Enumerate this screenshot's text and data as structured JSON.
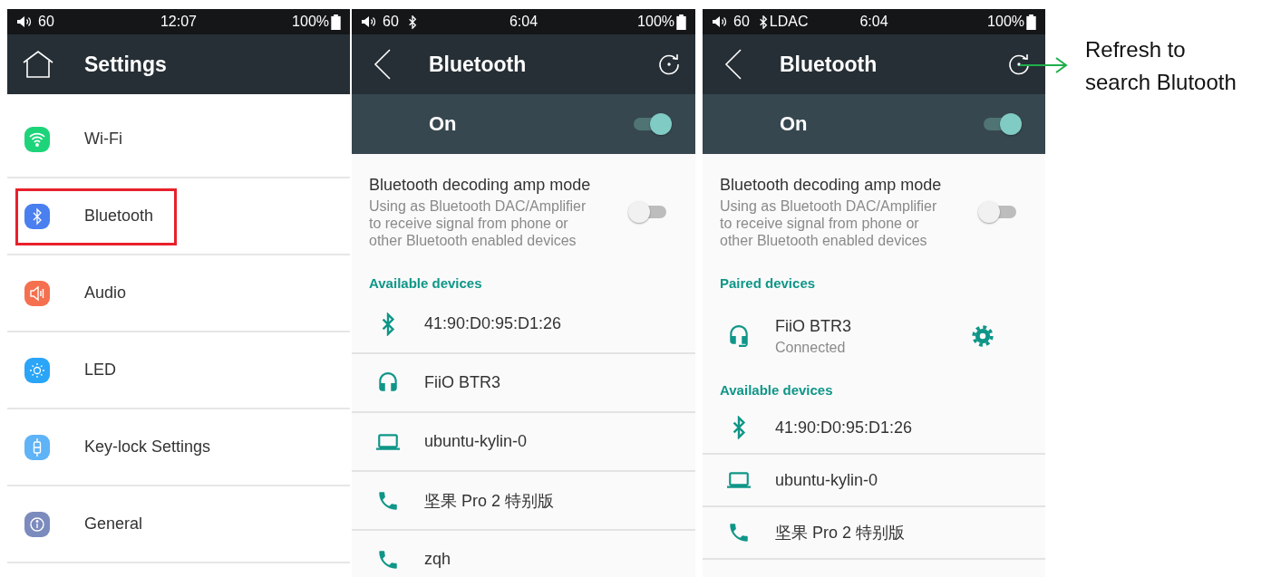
{
  "screens": [
    {
      "kind": "settings",
      "status_bar": {
        "volume": "60",
        "bluetooth": false,
        "time": "12:07",
        "battery": "100%"
      },
      "header": {
        "title": "Settings"
      },
      "items": [
        {
          "label": "Wi-Fi",
          "kind": "wifi",
          "color": "#1ed47a",
          "highlighted": false
        },
        {
          "label": "Bluetooth",
          "kind": "bluetooth",
          "color": "#4a7ff0",
          "highlighted": true
        },
        {
          "label": "Audio",
          "kind": "audio",
          "color": "#f4704f",
          "highlighted": false
        },
        {
          "label": "LED",
          "kind": "led",
          "color": "#2aa5f8",
          "highlighted": false
        },
        {
          "label": "Key-lock Settings",
          "kind": "keylock",
          "color": "#5fb3f7",
          "highlighted": false
        },
        {
          "label": "General",
          "kind": "general",
          "color": "#7c8bbd",
          "highlighted": false
        }
      ]
    },
    {
      "kind": "bluetooth",
      "status_bar": {
        "volume": "60",
        "bluetooth": true,
        "time": "6:04",
        "battery": "100%"
      },
      "header": {
        "title": "Bluetooth"
      },
      "switch": {
        "label": "On",
        "on": true
      },
      "amp_mode": {
        "title": "Bluetooth decoding amp mode",
        "description": "Using as Bluetooth DAC/Amplifier to receive signal from phone or other Bluetooth enabled devices",
        "on": false
      },
      "sections": [
        {
          "heading": "Available devices",
          "devices": [
            {
              "name": "41:90:D0:95:D1:26",
              "kind": "bluetooth",
              "has_settings": false
            },
            {
              "name": "FiiO BTR3",
              "kind": "headphones",
              "has_settings": false
            },
            {
              "name": "ubuntu-kylin-0",
              "kind": "laptop",
              "has_settings": false
            },
            {
              "name": "坚果 Pro 2 特别版",
              "kind": "phone",
              "has_settings": false
            },
            {
              "name": "zqh",
              "kind": "phone",
              "has_settings": false
            }
          ]
        }
      ]
    },
    {
      "kind": "bluetooth",
      "status_bar": {
        "volume": "60",
        "bluetooth": true,
        "codec": "LDAC",
        "time": "6:04",
        "battery": "100%"
      },
      "header": {
        "title": "Bluetooth"
      },
      "switch": {
        "label": "On",
        "on": true
      },
      "amp_mode": {
        "title": "Bluetooth decoding amp mode",
        "description": "Using as Bluetooth DAC/Amplifier to receive signal from phone or other Bluetooth enabled devices",
        "on": false
      },
      "sections": [
        {
          "heading": "Paired devices",
          "devices": [
            {
              "name": "FiiO BTR3",
              "kind": "headset",
              "status": "Connected",
              "has_settings": true
            }
          ]
        },
        {
          "heading": "Available devices",
          "devices": [
            {
              "name": "41:90:D0:95:D1:26",
              "kind": "bluetooth",
              "has_settings": false
            },
            {
              "name": "ubuntu-kylin-0",
              "kind": "laptop",
              "has_settings": false
            },
            {
              "name": "坚果 Pro 2 特别版",
              "kind": "phone",
              "has_settings": false
            }
          ]
        }
      ]
    }
  ],
  "annotation": {
    "text": "Refresh to\nsearch Blutooth"
  }
}
